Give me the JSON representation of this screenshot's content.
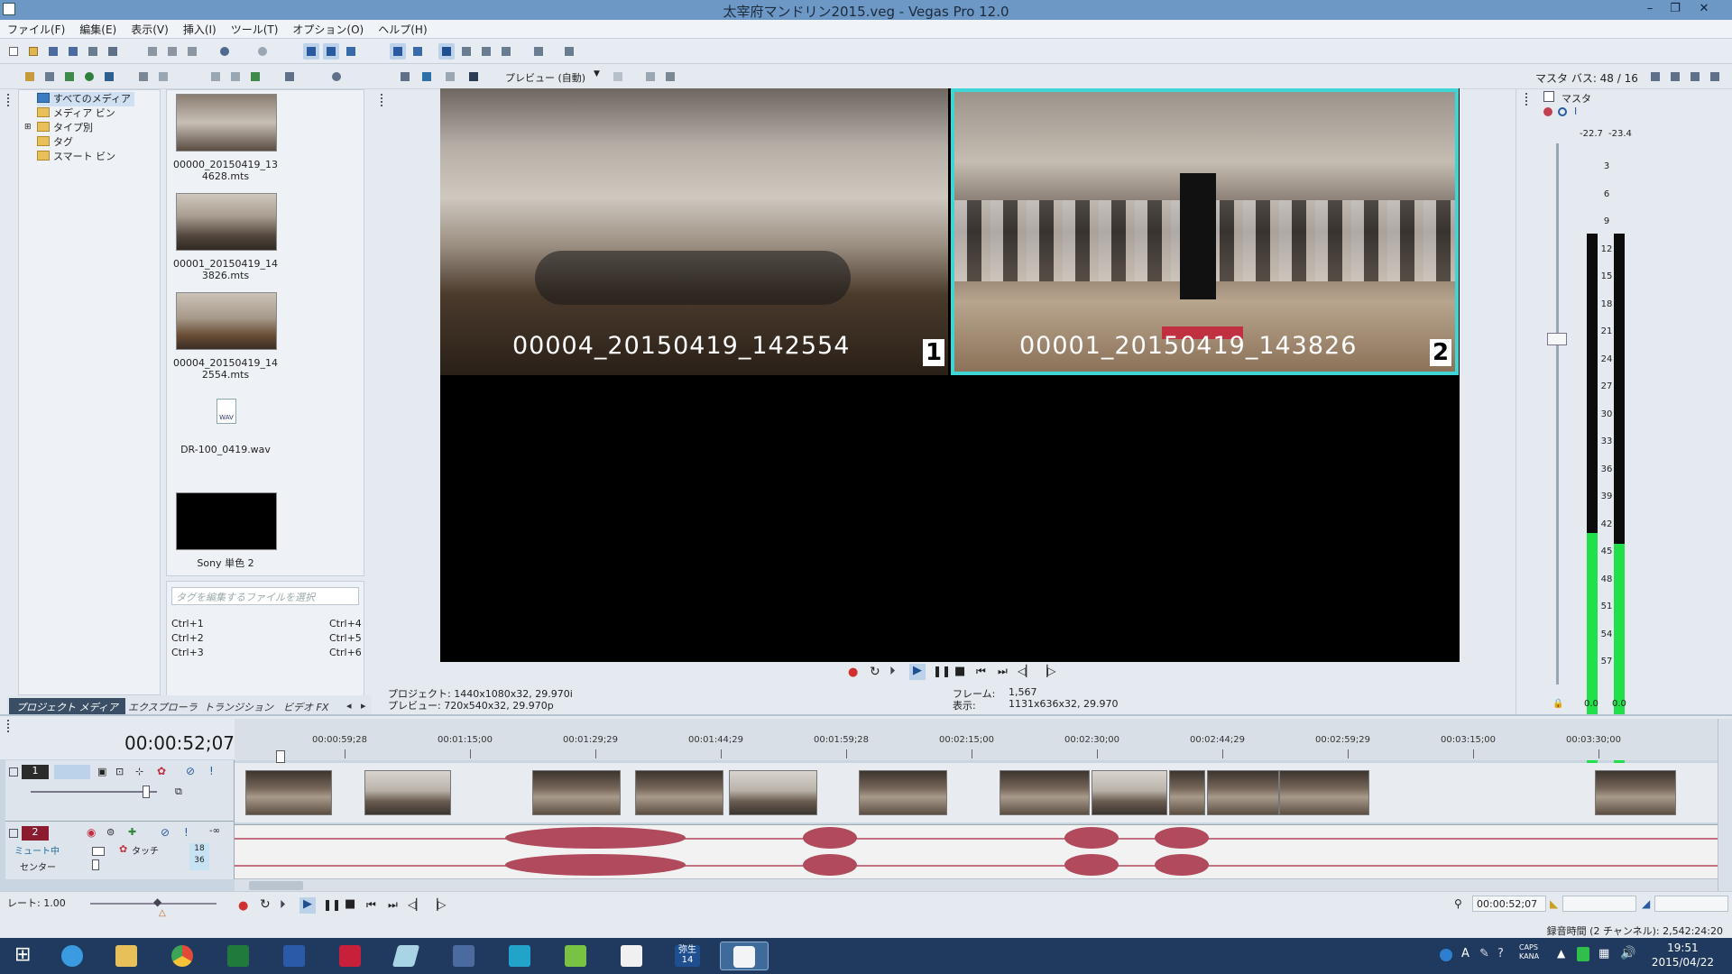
{
  "window": {
    "title": "太宰府マンドリン2015.veg - Vegas Pro 12.0",
    "min": "–",
    "max": "❐",
    "close": "✕"
  },
  "menu": [
    "ファイル(F)",
    "編集(E)",
    "表示(V)",
    "挿入(I)",
    "ツール(T)",
    "オプション(O)",
    "ヘルプ(H)"
  ],
  "media_tree": [
    {
      "label": "すべてのメディア",
      "selected": true
    },
    {
      "label": "メディア ビン"
    },
    {
      "label": "タイプ別"
    },
    {
      "label": "タグ"
    },
    {
      "label": "スマート ビン"
    }
  ],
  "media_items": [
    {
      "name": "00000_20150419_13\n4628.mts",
      "type": "video"
    },
    {
      "name": "00001_20150419_14\n3826.mts",
      "type": "video"
    },
    {
      "name": "00004_20150419_14\n2554.mts",
      "type": "video"
    },
    {
      "name": "DR-100_0419.wav",
      "type": "audio"
    },
    {
      "name": "Sony 単色 2",
      "type": "solid"
    }
  ],
  "tag_placeholder": "タグを編集するファイルを選択",
  "shortcuts_left": [
    "Ctrl+1",
    "Ctrl+2",
    "Ctrl+3"
  ],
  "shortcuts_right": [
    "Ctrl+4",
    "Ctrl+5",
    "Ctrl+6"
  ],
  "bottom_tabs": [
    "プロジェクト メディア",
    "エクスプローラ",
    "トランジション",
    "ビデオ FX"
  ],
  "preview": {
    "mode": "プレビュー (自動)",
    "cam1": {
      "label": "00004_20150419_142554",
      "num": "1"
    },
    "cam2": {
      "label": "00001_20150419_143826",
      "num": "2"
    },
    "project": "プロジェクト:  1440x1080x32, 29.970i",
    "preview_info": "プレビュー:    720x540x32, 29.970p",
    "frame_label": "フレーム:",
    "frame": "1,567",
    "display_label": "表示:",
    "display": "1131x636x32, 29.970"
  },
  "master": {
    "title": "マスタ バス: 48 / 16",
    "label": "マスタ",
    "peak_l": "-22.7",
    "peak_r": "-23.4",
    "ticks": [
      "3",
      "6",
      "9",
      "12",
      "15",
      "18",
      "21",
      "24",
      "27",
      "30",
      "33",
      "36",
      "39",
      "42",
      "45",
      "48",
      "51",
      "54",
      "57"
    ],
    "bottom_l": "0.0",
    "bottom_r": "0.0",
    "level_l": 0.46,
    "level_r": 0.44
  },
  "timeline": {
    "timecode": "00:00:52;07",
    "ruler": [
      "00:00:59;28",
      "00:01:15;00",
      "00:01:29;29",
      "00:01:44;29",
      "00:01:59;28",
      "00:02:15;00",
      "00:02:30;00",
      "00:02:44;29",
      "00:02:59;29",
      "00:03:15;00",
      "00:03:30;00"
    ],
    "track1_num": "1",
    "track2_num": "2",
    "mute": "ミュート中",
    "touch": "タッチ",
    "center": "センター",
    "vol_a": "18",
    "vol_b": "36",
    "rate": "レート: 1.00",
    "cursor": "00:00:52;07"
  },
  "status": "録音時間 (2 チャンネル): 2,542:24:20",
  "taskbar": {
    "yayoi": "弥生\n14",
    "time": "19:51",
    "date": "2015/04/22",
    "caps": "CAPS\nKANA"
  }
}
